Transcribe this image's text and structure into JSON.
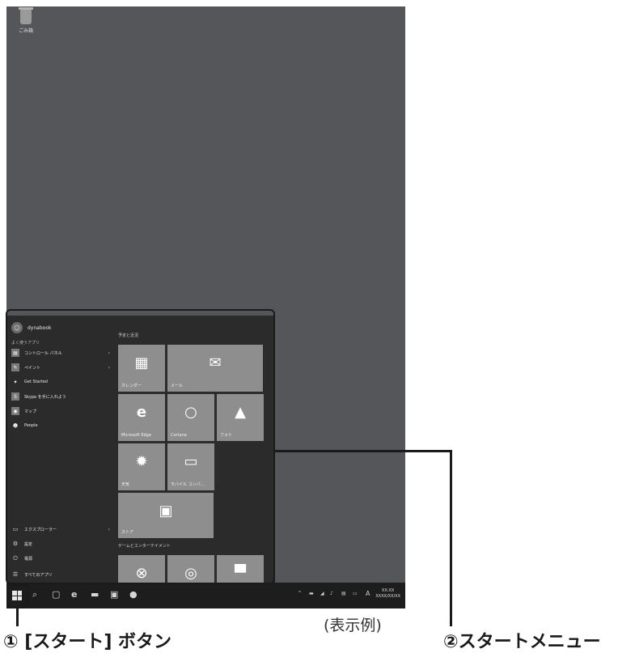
{
  "desktop": {
    "recycle_bin_label": "ごみ箱"
  },
  "start_menu": {
    "user_name": "dynabook",
    "frequent_label": "よく使うアプリ",
    "apps": [
      {
        "label": "コントロール パネル",
        "icon": "control-panel-icon",
        "arrow": "›"
      },
      {
        "label": "ペイント",
        "icon": "paint-icon",
        "arrow": "›"
      },
      {
        "label": "Get Started",
        "icon": "lightbulb-icon",
        "arrow": ""
      },
      {
        "label": "Skype を手に入れよう",
        "icon": "skype-icon",
        "arrow": ""
      },
      {
        "label": "マップ",
        "icon": "maps-icon",
        "arrow": ""
      },
      {
        "label": "People",
        "icon": "people-icon",
        "arrow": ""
      }
    ],
    "system": [
      {
        "label": "エクスプローラー",
        "icon": "folder-icon",
        "arrow": "›"
      },
      {
        "label": "設定",
        "icon": "gear-icon",
        "arrow": ""
      },
      {
        "label": "電源",
        "icon": "power-icon",
        "arrow": ""
      },
      {
        "label": "すべてのアプリ",
        "icon": "all-apps-icon",
        "arrow": ""
      }
    ],
    "group1_label": "予定と近況",
    "group2_label": "ゲームとエンターテイメント",
    "tiles": [
      {
        "label": "カレンダー",
        "icon": "calendar-icon",
        "glyph": "▦"
      },
      {
        "label": "メール",
        "icon": "mail-icon",
        "glyph": "✉"
      },
      {
        "label": "Microsoft Edge",
        "icon": "edge-icon",
        "glyph": "e"
      },
      {
        "label": "Cortana",
        "icon": "cortana-icon",
        "glyph": "○"
      },
      {
        "label": "フォト",
        "icon": "photos-icon",
        "glyph": "▲"
      },
      {
        "label": "天気",
        "icon": "weather-sun-icon",
        "glyph": "✹"
      },
      {
        "label": "モバイル コンパ...",
        "icon": "mobile-companion-icon",
        "glyph": "▭"
      },
      {
        "label": "ストア",
        "icon": "store-icon",
        "glyph": "▣"
      },
      {
        "label": "",
        "icon": "xbox-icon",
        "glyph": "⊗"
      },
      {
        "label": "",
        "icon": "groove-music-icon",
        "glyph": "◎"
      },
      {
        "label": "",
        "icon": "movies-icon",
        "glyph": "▀"
      }
    ]
  },
  "taskbar": {
    "icons": [
      "search-icon",
      "task-view-icon",
      "edge-icon",
      "file-explorer-icon",
      "store-icon",
      "info-icon"
    ],
    "tray": {
      "ime": "A",
      "clock_time": "XX:XX",
      "clock_date": "XXXX/XX/XX"
    }
  },
  "annotations": {
    "start_button_caption": "① [スタート] ボタン",
    "start_menu_caption": "②スタートメニュー",
    "example_label": "(表示例)"
  },
  "colors": {
    "tile": "#8e8e8e",
    "menu_bg": "#2b2b2b",
    "desktop": "#555659",
    "taskbar": "#1d1d1d"
  }
}
